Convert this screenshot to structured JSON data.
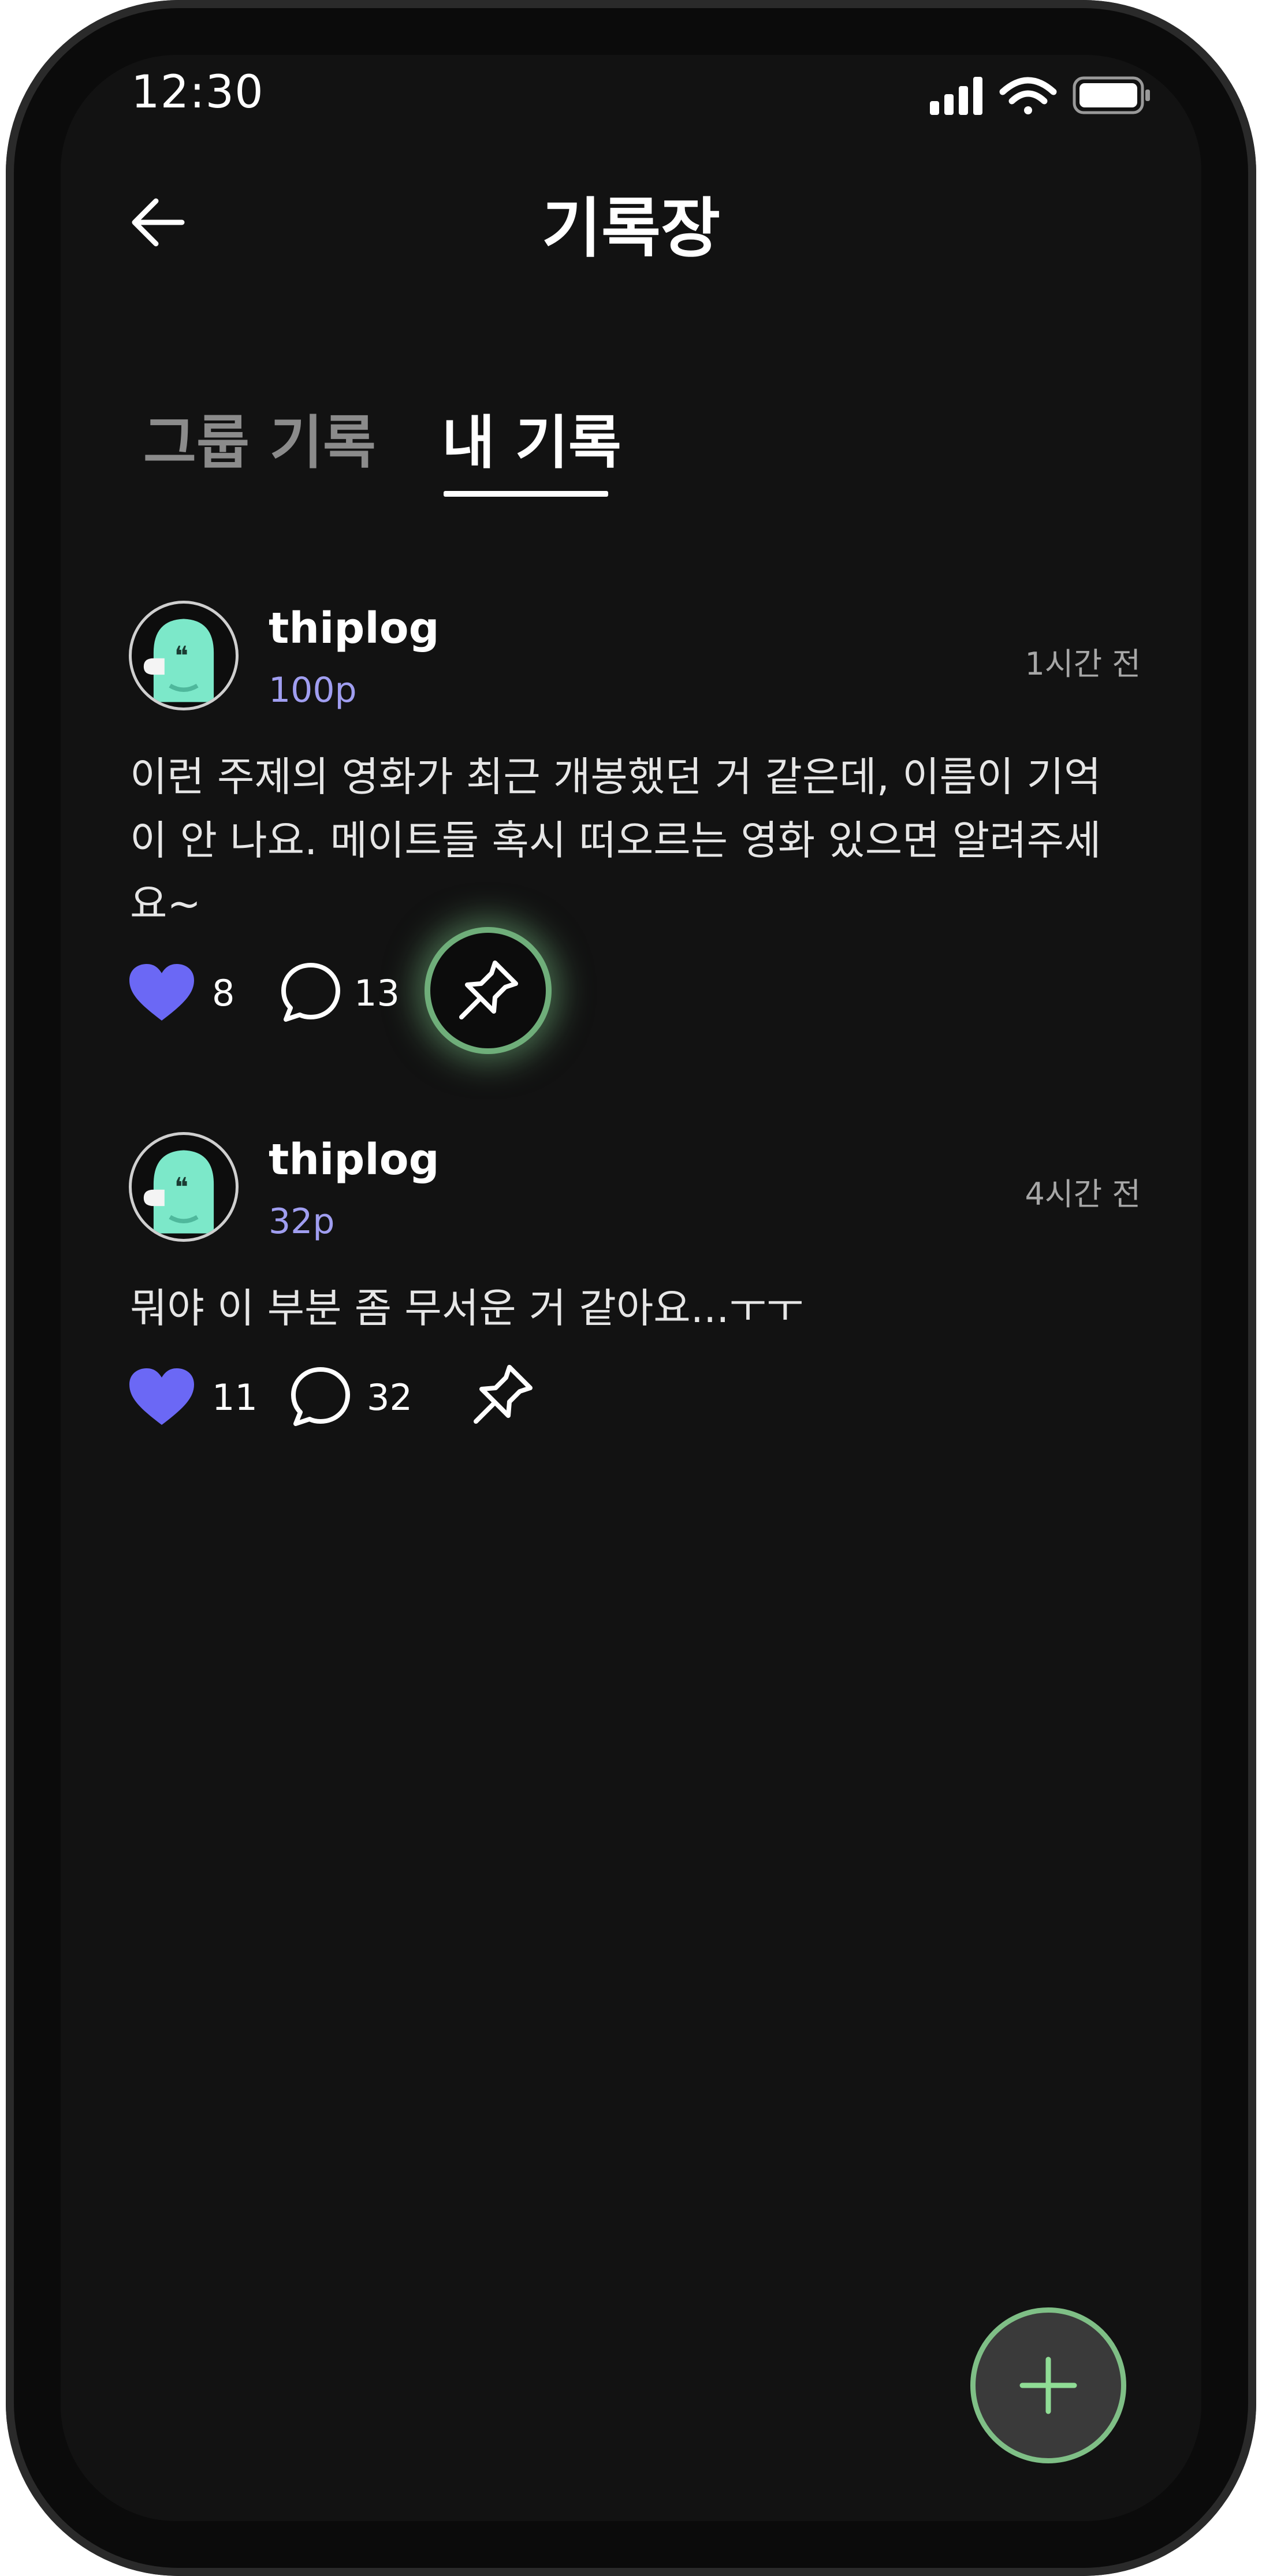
{
  "status_bar": {
    "time": "12:30"
  },
  "header": {
    "title": "기록장"
  },
  "tabs": [
    {
      "label": "그룹 기록",
      "active": false
    },
    {
      "label": "내 기록",
      "active": true
    }
  ],
  "posts": [
    {
      "username": "thiplog",
      "points": "100p",
      "time_ago": "1시간 전",
      "lines": [
        "이런 주제의 영화가 최근 개봉했던 거 같은데, 이름이 기억",
        "이 안 나요. 메이트들 혹시 떠오르는 영화 있으면 알려주세",
        "요~"
      ],
      "likes": "8",
      "comments": "13",
      "pinned_highlight": true
    },
    {
      "username": "thiplog",
      "points": "32p",
      "time_ago": "4시간 전",
      "lines": [
        "뭐야 이 부분 좀 무서운 거 같아요...ㅜㅜ"
      ],
      "likes": "11",
      "comments": "32",
      "pinned_highlight": false
    }
  ],
  "icons": {
    "back": "arrow-left-icon",
    "like": "heart-icon",
    "comment": "speech-bubble-icon",
    "pin": "pin-icon",
    "add": "plus-icon"
  },
  "colors": {
    "background": "#121212",
    "accent_heart": "#6b68f5",
    "points": "#a09ef0",
    "fab_border": "#7fbf86",
    "fab_plus": "#8fdc95"
  }
}
